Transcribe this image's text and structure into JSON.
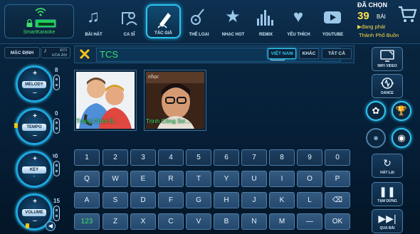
{
  "brand": {
    "label": "SmartKaraoke"
  },
  "tabs": [
    {
      "label": "BÀI HÁT",
      "icon": "music-note-icon"
    },
    {
      "label": "CA SĨ",
      "icon": "singer-icon"
    },
    {
      "label": "TÁC GIẢ",
      "icon": "pen-icon"
    },
    {
      "label": "THỂ LOẠI",
      "icon": "guitar-icon"
    },
    {
      "label": "NHẠC HOT",
      "icon": "star-icon"
    },
    {
      "label": "REMIX",
      "icon": "equalizer-icon"
    },
    {
      "label": "YÊU THÍCH",
      "icon": "heart-icon"
    },
    {
      "label": "YOUTUBE",
      "icon": "youtube-icon"
    }
  ],
  "active_tab": "TÁC GIẢ",
  "queue": {
    "heading": "ĐÃ CHỌN",
    "count": "39",
    "unit": "BÀI",
    "status": "▶đang phát",
    "current": "Thành Phố Buồn"
  },
  "left": {
    "default_label": "MẶC ĐỊNH",
    "harmony_label_1": "ĐỔI",
    "harmony_label_2": "HÒA ÂM",
    "melody": {
      "label": "MELODY",
      "level": "8"
    },
    "tempo": {
      "label": "TEMPO",
      "level": "0"
    },
    "key": {
      "label": "KEY",
      "sub": "♭",
      "level": "♮0"
    },
    "volume": {
      "label": "VOLUME",
      "level": "15"
    }
  },
  "search": {
    "value": "TCS",
    "backspace": "⌫",
    "clear": "✕"
  },
  "filters": [
    {
      "label": "VIỆT NAM",
      "active": true
    },
    {
      "label": "KHÁC",
      "active": false
    },
    {
      "label": "TẤT CẢ",
      "active": false
    }
  ],
  "results": [
    {
      "name": "Trang Chim B..."
    },
    {
      "name": "Trịnh Công Sơ...",
      "photo_text": "nhạc"
    }
  ],
  "keyboard": {
    "row1": [
      "1",
      "2",
      "3",
      "4",
      "5",
      "6",
      "7",
      "8",
      "9",
      "0"
    ],
    "row2": [
      "Q",
      "W",
      "E",
      "R",
      "T",
      "Y",
      "U",
      "I",
      "O",
      "P"
    ],
    "row3": [
      "A",
      "S",
      "D",
      "F",
      "G",
      "H",
      "J",
      "K",
      "L",
      "⌫"
    ],
    "row4": [
      "123",
      "Z",
      "X",
      "C",
      "V",
      "B",
      "N",
      "M",
      "—",
      "OK"
    ]
  },
  "right": {
    "wifi_video": "WIFI VIDEO",
    "dance": "DANCE",
    "replay": "HÁT LẠI",
    "pause": "TẠM DỪNG",
    "skip": "QUA BÀI"
  },
  "colors": {
    "accent": "#2ec4f0",
    "text_green": "#3fe06b",
    "yellow": "#f2c318"
  }
}
